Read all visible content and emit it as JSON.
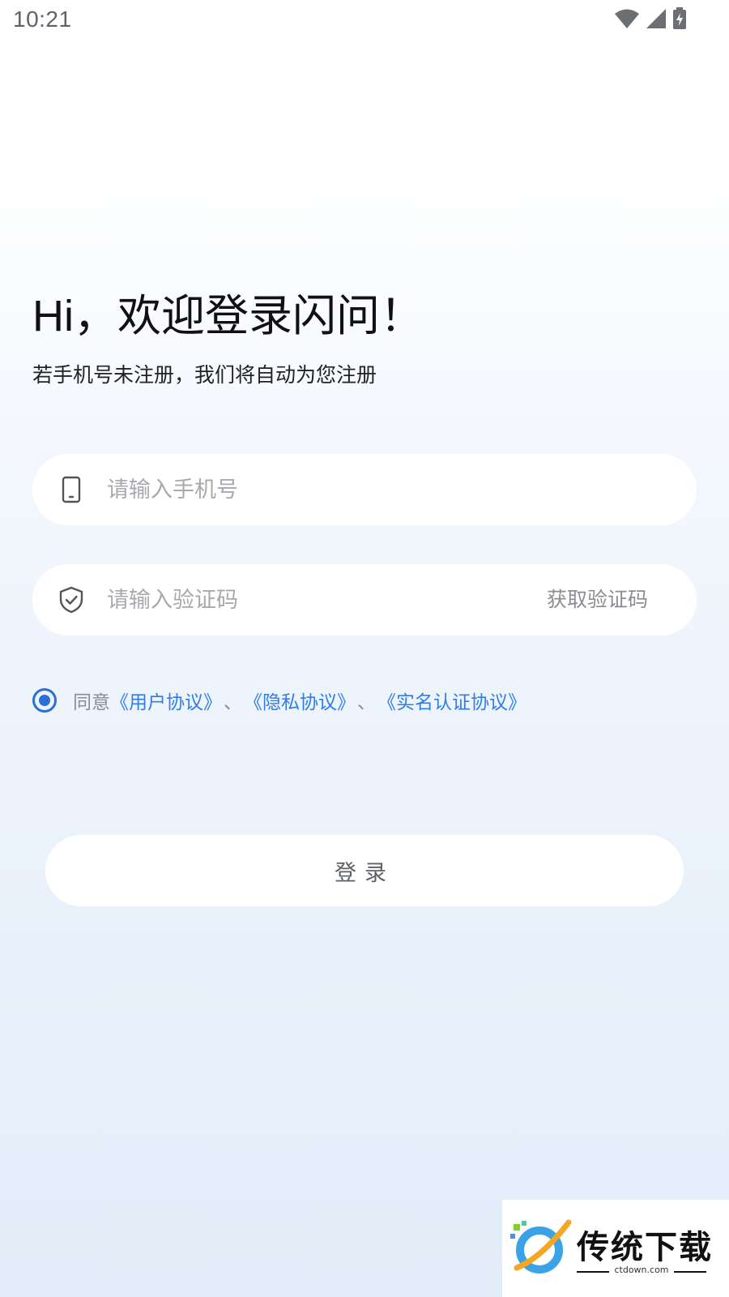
{
  "status_bar": {
    "time": "10:21"
  },
  "login": {
    "greeting": "Hi，欢迎登录闪问！",
    "subtitle": "若手机号未注册，我们将自动为您注册",
    "phone": {
      "placeholder": "请输入手机号",
      "value": ""
    },
    "code": {
      "placeholder": "请输入验证码",
      "value": "",
      "get_code_label": "获取验证码"
    },
    "agreement": {
      "checked": true,
      "prefix": "同意",
      "links": [
        "《用户协议》",
        "《隐私协议》",
        "《实名认证协议》"
      ],
      "separator": "、"
    },
    "login_button": "登录"
  },
  "watermark": {
    "title": "传统下载",
    "subtitle": "ctdown.com"
  },
  "colors": {
    "accent": "#2c6fd6",
    "link": "#2f7ee8",
    "placeholder": "#a7a9ad"
  }
}
